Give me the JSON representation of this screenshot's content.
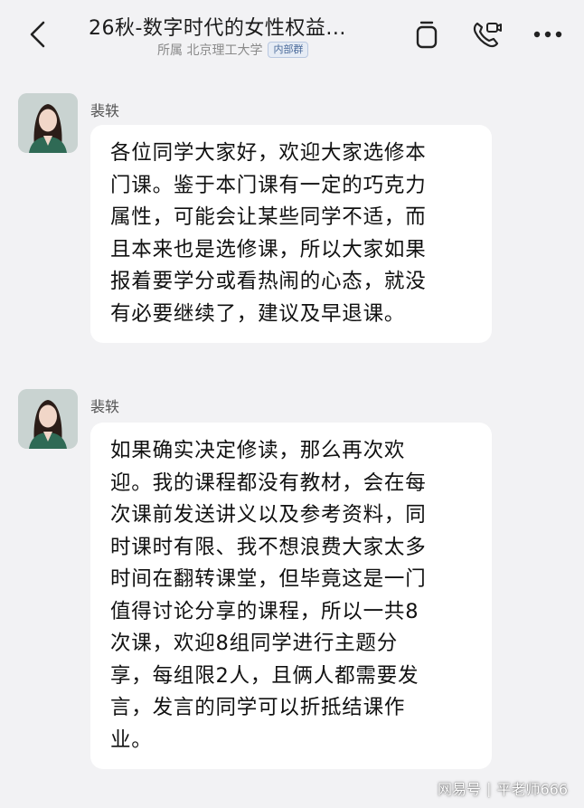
{
  "header": {
    "title": "26秋-数字时代的女性权益...",
    "subtitle": "所属 北京理工大学",
    "badge": "内部群",
    "icons": [
      "back-icon",
      "copy-icon",
      "video-call-icon",
      "more-icon"
    ]
  },
  "messages": [
    {
      "sender": "裴轶",
      "lines": [
        "各位同学大家好，欢迎大家选修本",
        "门课。鉴于本门课有一定的巧克力",
        "属性，可能会让某些同学不适，而",
        "且本来也是选修课，所以大家如果",
        "报着要学分或看热闹的心态，就没",
        "有必要继续了，建议及早退课。"
      ]
    },
    {
      "sender": "裴轶",
      "lines": [
        "如果确实决定修读，那么再次欢",
        "迎。我的课程都没有教材，会在每",
        "次课前发送讲义以及参考资料，同",
        "时课时有限、我不想浪费大家太多",
        "时间在翻转课堂，但毕竟这是一门",
        "值得讨论分享的课程，所以一共8",
        "次课，欢迎8组同学进行主题分",
        "享，每组限2人，且俩人都需要发",
        "言，发言的同学可以折抵结课作",
        "业。"
      ]
    }
  ],
  "watermark": {
    "left": "网易号",
    "sep": "|",
    "right": "平老师666"
  }
}
